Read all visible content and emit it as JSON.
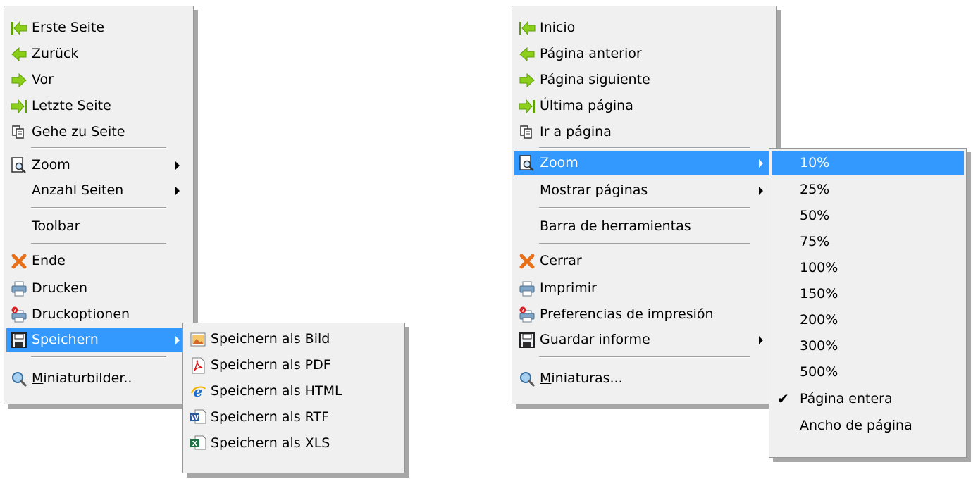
{
  "menu_de": {
    "items": [
      {
        "label": "Erste Seite",
        "icon": "first-page-arrow-icon"
      },
      {
        "label": "Zurück",
        "icon": "back-arrow-icon"
      },
      {
        "label": "Vor",
        "icon": "forward-arrow-icon"
      },
      {
        "label": "Letzte Seite",
        "icon": "last-page-arrow-icon"
      },
      {
        "label": "Gehe zu Seite",
        "icon": "pages-icon"
      },
      {
        "label": "Zoom",
        "icon": "zoom-page-icon"
      },
      {
        "label": "Anzahl Seiten"
      },
      {
        "label": "Toolbar"
      },
      {
        "label": "Ende",
        "icon": "close-x-icon"
      },
      {
        "label": "Drucken",
        "icon": "printer-icon"
      },
      {
        "label": "Druckoptionen",
        "icon": "printer-options-icon"
      },
      {
        "label": "Speichern",
        "icon": "save-disk-icon"
      },
      {
        "label_mnemonic": "M",
        "label_rest": "iniaturbilder..",
        "icon": "magnifier-icon"
      }
    ],
    "save_submenu": [
      {
        "label": "Speichern als Bild",
        "icon": "image-file-icon"
      },
      {
        "label": "Speichern als PDF",
        "icon": "pdf-file-icon"
      },
      {
        "label": "Speichern als HTML",
        "icon": "html-file-icon"
      },
      {
        "label": "Speichern als RTF",
        "icon": "word-file-icon"
      },
      {
        "label": "Speichern als XLS",
        "icon": "excel-file-icon"
      }
    ]
  },
  "menu_es": {
    "items": [
      {
        "label": "Inicio",
        "icon": "first-page-arrow-icon"
      },
      {
        "label": "Página anterior",
        "icon": "back-arrow-icon"
      },
      {
        "label": "Página siguiente",
        "icon": "forward-arrow-icon"
      },
      {
        "label": "Última página",
        "icon": "last-page-arrow-icon"
      },
      {
        "label": "Ir a página",
        "icon": "pages-icon"
      },
      {
        "label": "Zoom",
        "icon": "zoom-page-icon"
      },
      {
        "label": "Mostrar páginas"
      },
      {
        "label": "Barra de herramientas"
      },
      {
        "label": "Cerrar",
        "icon": "close-x-icon"
      },
      {
        "label": "Imprimir",
        "icon": "printer-icon"
      },
      {
        "label": "Preferencias de impresión",
        "icon": "printer-options-icon"
      },
      {
        "label": "Guardar informe",
        "icon": "save-disk-icon"
      },
      {
        "label_mnemonic": "M",
        "label_rest": "iniaturas...",
        "icon": "magnifier-icon"
      }
    ],
    "zoom_submenu": [
      {
        "label": "10%"
      },
      {
        "label": "25%"
      },
      {
        "label": "50%"
      },
      {
        "label": "75%"
      },
      {
        "label": "100%"
      },
      {
        "label": "150%"
      },
      {
        "label": "200%"
      },
      {
        "label": "300%"
      },
      {
        "label": "500%"
      },
      {
        "label": "Página entera",
        "checked": true
      },
      {
        "label": "Ancho de página"
      }
    ],
    "check_glyph": "✔"
  },
  "colors": {
    "highlight": "#3399ff",
    "menu_background": "#f0f0f0",
    "arrow_green": "#7ac70c"
  }
}
